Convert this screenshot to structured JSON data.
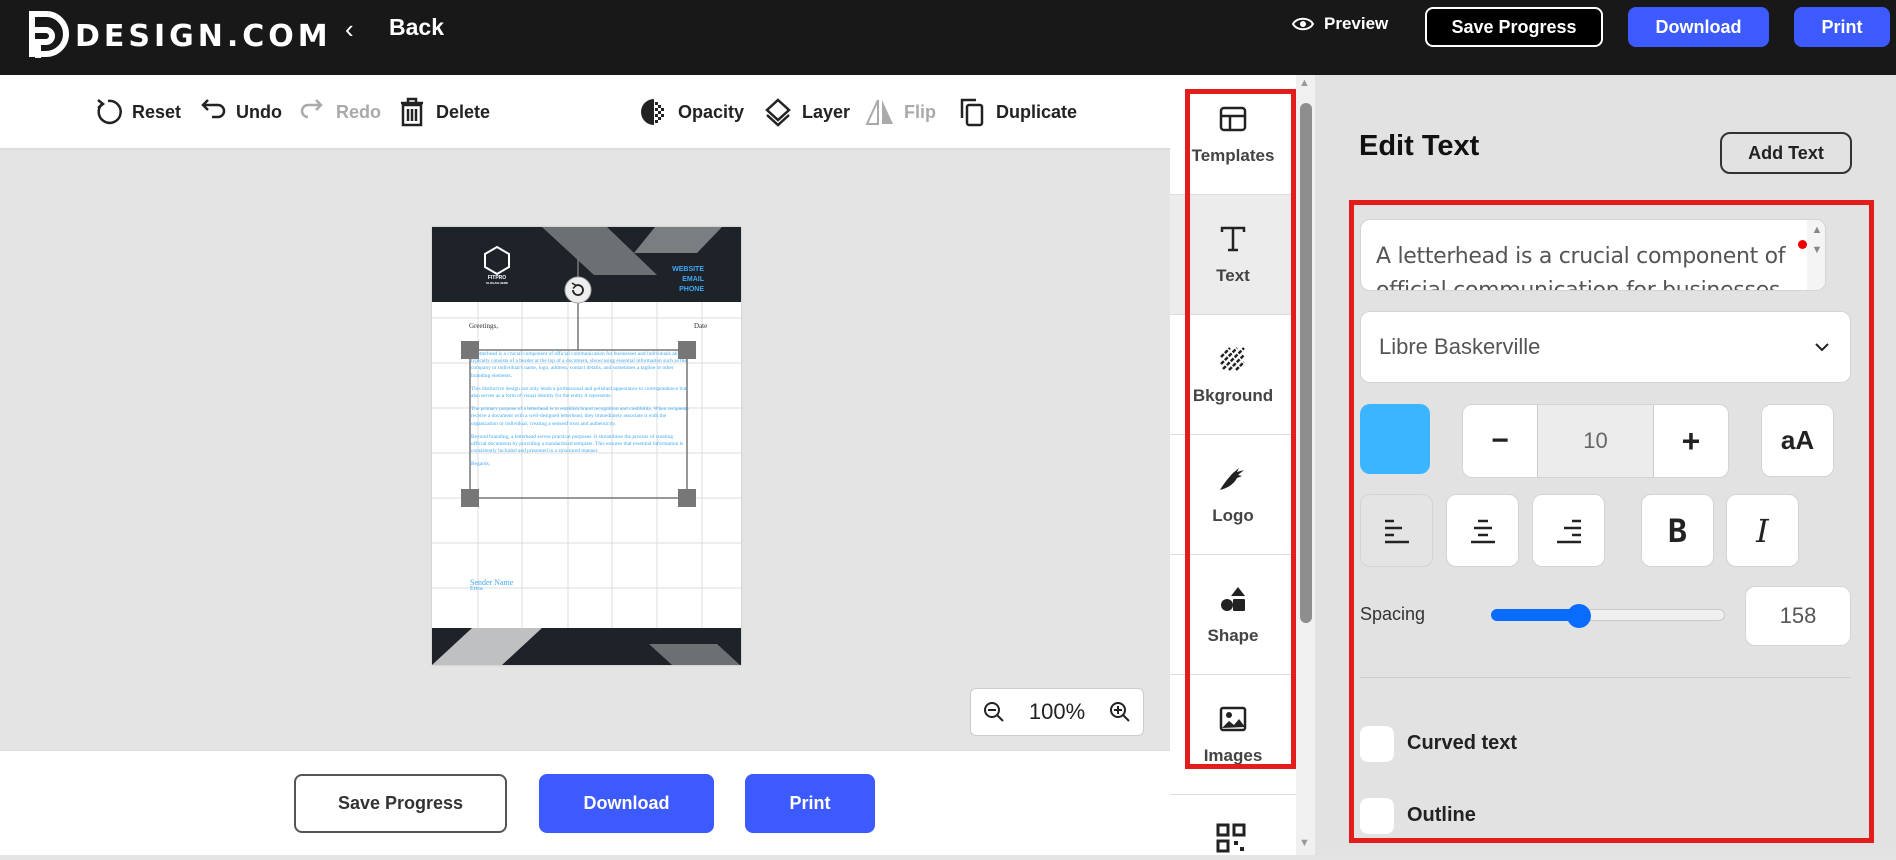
{
  "header": {
    "brand": "DESIGN.COM",
    "back": "Back",
    "preview": "Preview",
    "save_progress": "Save Progress",
    "download": "Download",
    "print": "Print"
  },
  "toolbar": {
    "reset": "Reset",
    "undo": "Undo",
    "redo": "Redo",
    "delete": "Delete",
    "opacity": "Opacity",
    "layer": "Layer",
    "flip": "Flip",
    "duplicate": "Duplicate"
  },
  "document": {
    "logo_name": "FITPRO",
    "logo_slogan": "SLOGAN HERE",
    "contact": [
      "WEBSITE",
      "EMAIL",
      "PHONE"
    ],
    "greeting": "Greetings,",
    "date": "Date",
    "paragraphs": [
      "A letterhead is a crucial component of official communication for businesses and individuals alike. It typically consists of a header at the top of a document, showcasing essential information such as the company or individual's name, logo, address, contact details, and sometimes a tagline or other branding elements.",
      "This distinctive design not only lends a professional and polished appearance to correspondence but also serves as a form of visual identity for the entity it represents.",
      "The primary purpose of a letterhead is to establish brand recognition and credibility. When recipients receive a document with a well-designed letterhead, they immediately associate it with the organization or individual, creating a senseof trust and authenticity.",
      "Beyond branding, a letterhead serves practical purposes. It streamlines the process of creating official documents by providing a standardized template. This ensures that essential information is consistently included and presented in a structured manner."
    ],
    "closing": "Regards,",
    "sender_name": "Sender Name",
    "sender": "Erica"
  },
  "zoom": {
    "level": "100%"
  },
  "bottom": {
    "save_progress": "Save Progress",
    "download": "Download",
    "print": "Print"
  },
  "sidebar": {
    "items": [
      {
        "label": "Templates"
      },
      {
        "label": "Text"
      },
      {
        "label": "Bkground"
      },
      {
        "label": "Logo"
      },
      {
        "label": "Shape"
      },
      {
        "label": "Images"
      }
    ]
  },
  "panel": {
    "title": "Edit Text",
    "add_text": "Add Text",
    "text_value": "A letterhead is a crucial component of official communication for businesses and individuals alike.",
    "font": "Libre Baskerville",
    "color": "#3bb5ff",
    "font_size": "10",
    "case_label": "aA",
    "bold": "B",
    "italic": "I",
    "spacing_label": "Spacing",
    "spacing_value": "158",
    "spacing_fraction": 0.37,
    "curved_text": "Curved text",
    "outline": "Outline"
  },
  "colors": {
    "accent": "#3d5afe",
    "highlight": "#e31c1c"
  }
}
